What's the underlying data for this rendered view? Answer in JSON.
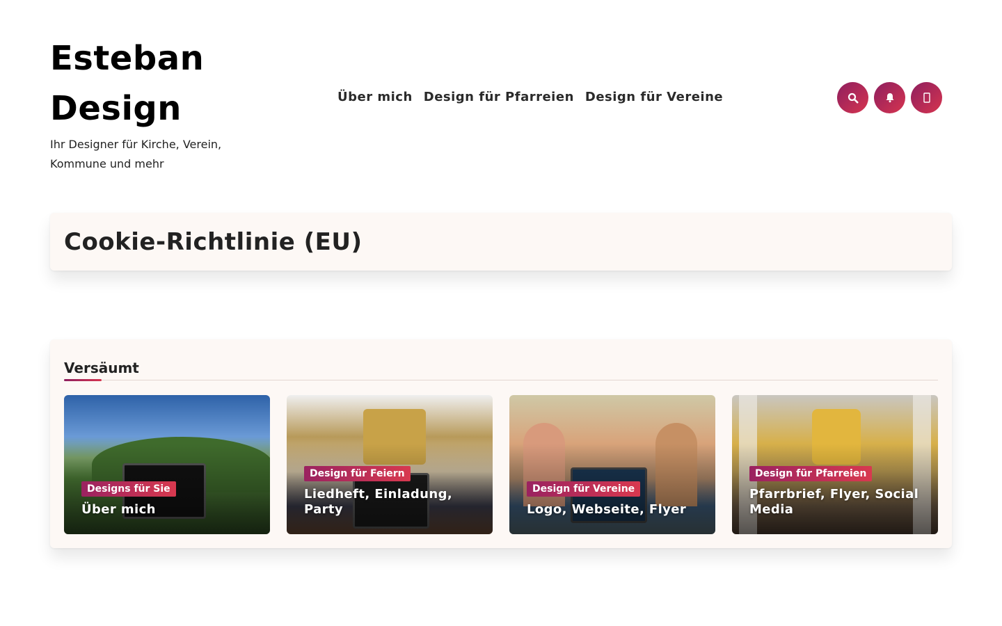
{
  "site": {
    "title_line1": "Esteban",
    "title_line2": "Design",
    "tagline": "Ihr Designer für Kirche, Verein, Kommune und mehr"
  },
  "nav": {
    "items": [
      {
        "label": "Über mich"
      },
      {
        "label": "Design für Pfarreien"
      },
      {
        "label": "Design für Vereine"
      }
    ]
  },
  "header_actions": [
    {
      "icon": "search-icon"
    },
    {
      "icon": "bell-icon"
    },
    {
      "icon": "mobile-icon"
    }
  ],
  "page": {
    "title": "Cookie-Richtlinie (EU)"
  },
  "missed": {
    "heading": "Versäumt",
    "cards": [
      {
        "badge": "Designs für Sie",
        "title": "Über mich"
      },
      {
        "badge": "Design für Feiern",
        "title": "Liedheft, Einladung, Party"
      },
      {
        "badge": "Design für Vereine",
        "title": "Logo, Webseite, Flyer"
      },
      {
        "badge": "Design für Pfarreien",
        "title": "Pfarrbrief, Flyer, Social Media"
      }
    ]
  },
  "colors": {
    "accent_start": "#8e1f5f",
    "accent_end": "#d6344f",
    "card_bg": "#fdf8f5"
  }
}
